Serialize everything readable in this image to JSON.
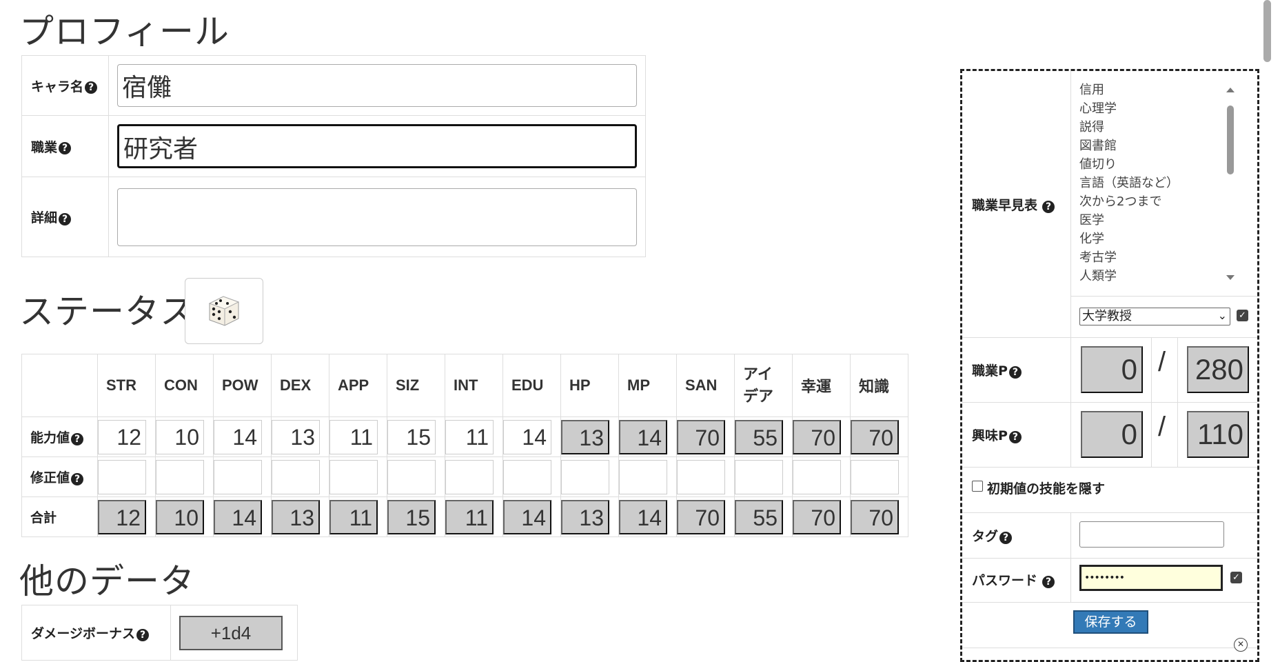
{
  "profile": {
    "heading": "プロフィール",
    "name_label": "キャラ名",
    "name_value": "宿儺",
    "job_label": "職業",
    "job_value": "研究者",
    "detail_label": "詳細",
    "detail_value": ""
  },
  "status": {
    "heading": "ステータス",
    "dice_icon": "dice-icon",
    "columns": [
      "STR",
      "CON",
      "POW",
      "DEX",
      "APP",
      "SIZ",
      "INT",
      "EDU",
      "HP",
      "MP",
      "SAN",
      "アイデア",
      "幸運",
      "知識"
    ],
    "col_idea_line1": "アイ",
    "col_idea_line2": "デア",
    "row_ability": "能力値",
    "row_mod": "修正値",
    "row_total": "合計",
    "ability": [
      "12",
      "10",
      "14",
      "13",
      "11",
      "15",
      "11",
      "14",
      "13",
      "14",
      "70",
      "55",
      "70",
      "70"
    ],
    "mod": [
      "",
      "",
      "",
      "",
      "",
      "",
      "",
      "",
      "",
      "",
      "",
      "",
      "",
      ""
    ],
    "total": [
      "12",
      "10",
      "14",
      "13",
      "11",
      "15",
      "11",
      "14",
      "13",
      "14",
      "70",
      "55",
      "70",
      "70"
    ]
  },
  "other": {
    "heading": "他のデータ",
    "damage_label": "ダメージボーナス",
    "damage_value": "+1d4"
  },
  "side": {
    "job_table_label": "職業早見表",
    "skills": [
      "信用",
      "心理学",
      "説得",
      "図書館",
      "値切り",
      "言語（英語など）",
      "次から2つまで",
      "医学",
      "化学",
      "考古学",
      "人類学"
    ],
    "job_select": "大学教授",
    "job_points_label": "職業P",
    "job_points_used": "0",
    "job_points_total": "280",
    "interest_points_label": "興味P",
    "interest_points_used": "0",
    "interest_points_total": "110",
    "slash": "/",
    "hide_initial_label": "初期値の技能を隠す",
    "tag_label": "タグ",
    "tag_value": "",
    "password_label": "パスワード",
    "password_value": "••••••••",
    "save_label": "保存する"
  },
  "colors": {
    "save_button": "#337ab7",
    "password_bg": "#ffffdd",
    "readonly_bg": "#cccccc"
  }
}
